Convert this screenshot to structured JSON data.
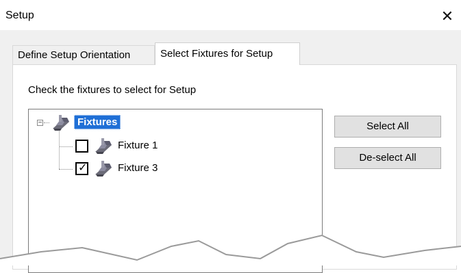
{
  "window": {
    "title": "Setup",
    "close_glyph": "✕"
  },
  "tabs": [
    {
      "label": "Define Setup Orientation",
      "active": false
    },
    {
      "label": "Select Fixtures for Setup",
      "active": true
    }
  ],
  "panel": {
    "instruction": "Check the fixtures to select for Setup",
    "tree": {
      "root": {
        "label": "Fixtures",
        "expanded": true,
        "expander_glyph": "−",
        "icon": "fixture-icon"
      },
      "children": [
        {
          "label": "Fixture 1",
          "checked": false,
          "icon": "fixture-icon"
        },
        {
          "label": "Fixture 3",
          "checked": true,
          "check_glyph": "✓",
          "icon": "fixture-icon"
        }
      ]
    },
    "buttons": {
      "select_all": "Select All",
      "deselect_all": "De-select All"
    }
  },
  "colors": {
    "selection": "#1f6fd6",
    "button_face": "#e1e1e1",
    "dialog_bg": "#f0f0f0"
  }
}
